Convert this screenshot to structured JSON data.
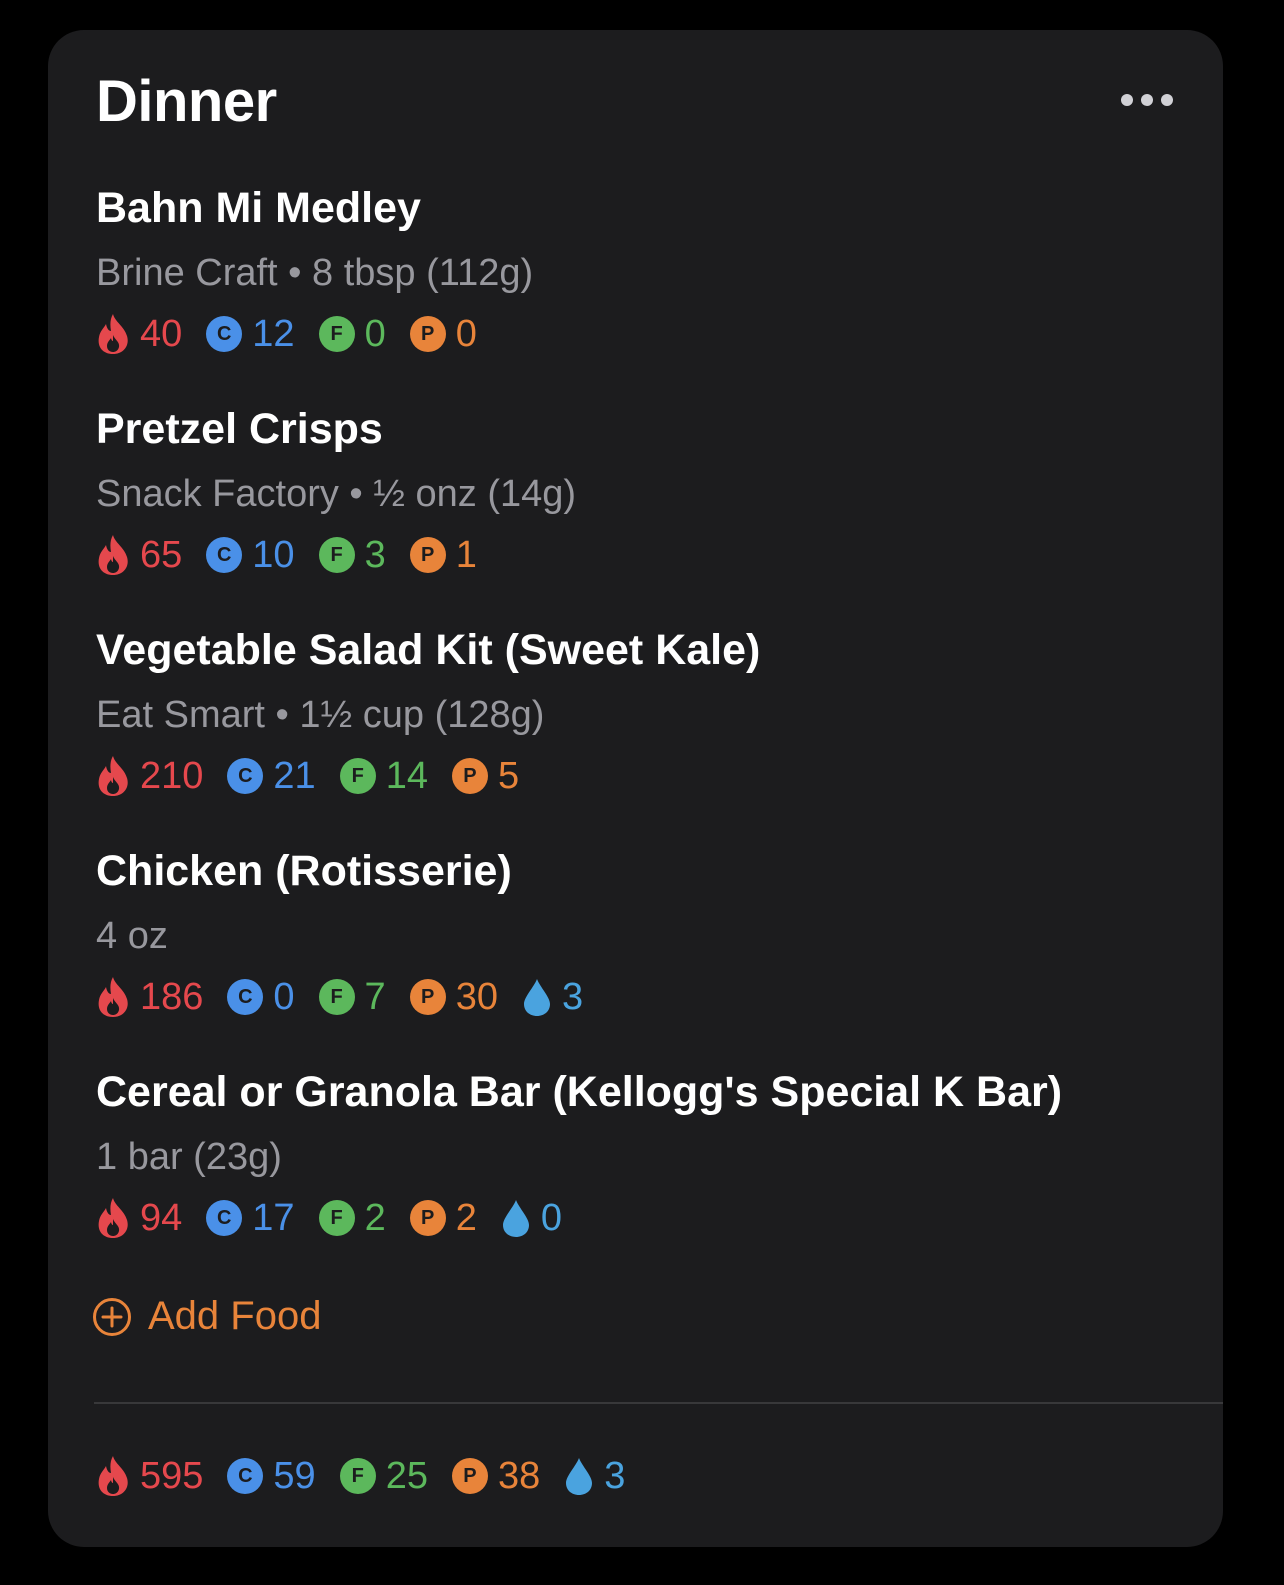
{
  "meal": {
    "title": "Dinner"
  },
  "foods": [
    {
      "name": "Bahn Mi Medley",
      "detail": "Brine Craft • 8 tbsp (112g)",
      "calories": "40",
      "carbs": "12",
      "fat": "0",
      "protein": "0"
    },
    {
      "name": "Pretzel Crisps",
      "detail": "Snack Factory • ½ onz (14g)",
      "calories": "65",
      "carbs": "10",
      "fat": "3",
      "protein": "1"
    },
    {
      "name": "Vegetable Salad Kit (Sweet Kale)",
      "detail": "Eat Smart • 1½ cup (128g)",
      "calories": "210",
      "carbs": "21",
      "fat": "14",
      "protein": "5"
    },
    {
      "name": "Chicken (Rotisserie)",
      "detail": "4 oz",
      "calories": "186",
      "carbs": "0",
      "fat": "7",
      "protein": "30",
      "water": "3"
    },
    {
      "name": "Cereal or Granola Bar (Kellogg's Special K Bar)",
      "detail": "1 bar (23g)",
      "calories": "94",
      "carbs": "17",
      "fat": "2",
      "protein": "2",
      "water": "0"
    }
  ],
  "add_food": {
    "label": "Add Food"
  },
  "totals": {
    "calories": "595",
    "carbs": "59",
    "fat": "25",
    "protein": "38",
    "water": "3"
  },
  "badges": {
    "carbs": "C",
    "fat": "F",
    "protein": "P"
  },
  "colors": {
    "background": "#000000",
    "card": "#1c1c1e",
    "calories": "#e5484d",
    "carbs": "#4a90e8",
    "fat": "#5cb85c",
    "protein": "#e8843a",
    "water": "#4aa3df",
    "accent": "#e8843a",
    "secondary_text": "#98989e"
  },
  "icons": {
    "calories": "flame-icon",
    "water": "water-drop-icon",
    "add": "plus-circle-icon",
    "more": "ellipsis-icon"
  }
}
